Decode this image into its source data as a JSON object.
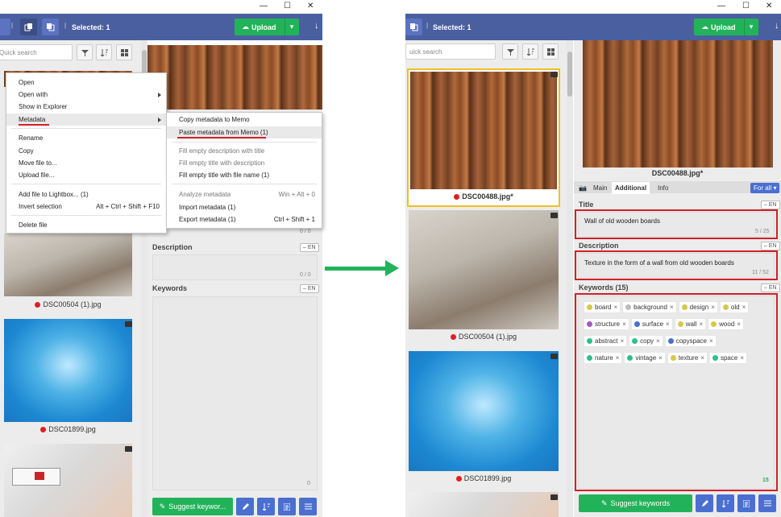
{
  "left": {
    "selected_label": "Selected: 1",
    "upload_label": "Upload",
    "search_placeholder": "Quick search",
    "thumbs": [
      {
        "caption": "DSC00504 (1).jpg"
      },
      {
        "caption": "DSC01899.jpg"
      }
    ],
    "context_menu": {
      "items": [
        "Open",
        "Open with",
        "Show in Explorer",
        "Metadata",
        "Rename",
        "Copy",
        "Move file to...",
        "Upload file...",
        "Add file to Lightbox... (1)",
        "Invert selection",
        "Delete file"
      ],
      "invert_shortcut": "Alt + Ctrl + Shift + F10"
    },
    "submenu": {
      "items": [
        "Copy metadata to Memo",
        "Paste metadata from Memo (1)",
        "Fill empty description with title",
        "Fill empty title with description",
        "Fill empty title with file name (1)",
        "Analyze metadata",
        "Import metadata (1)",
        "Export metadata (1)"
      ],
      "analyze_shortcut": "Win + Alt + 0",
      "export_shortcut": "Ctrl + Shift + 1"
    },
    "fields": {
      "title_counter": "0 / 0",
      "description_label": "Description",
      "description_counter": "0 / 0",
      "keywords_label": "Keywords",
      "keywords_counter": "0",
      "lang": "EN"
    },
    "suggest_label": "Suggest keywor..."
  },
  "right": {
    "selected_label": "Selected: 1",
    "upload_label": "Upload",
    "search_placeholder": "uick search",
    "thumbs": [
      {
        "caption": "DSC00488.jpg*"
      },
      {
        "caption": "DSC00504 (1).jpg"
      },
      {
        "caption": "DSC01899.jpg"
      }
    ],
    "preview_filename": "DSC00488.jpg*",
    "tabs": [
      "Main",
      "Additional",
      "Info"
    ],
    "for_all": "For all",
    "title_label": "Title",
    "title_value": "Wall of old wooden boards",
    "title_counter": "5 / 25",
    "description_label": "Description",
    "description_value": "Texture in the form of a wall from old wooden boards",
    "description_counter": "11 / 52",
    "keywords_label": "Keywords (15)",
    "keywords_counter": "15",
    "lang": "EN",
    "keywords": [
      {
        "text": "board",
        "color": "#d6c94a"
      },
      {
        "text": "background",
        "color": "#bbbbbb"
      },
      {
        "text": "design",
        "color": "#d6c94a"
      },
      {
        "text": "old",
        "color": "#d6c94a"
      },
      {
        "text": "structure",
        "color": "#a25ac8"
      },
      {
        "text": "surface",
        "color": "#4a6fd0"
      },
      {
        "text": "wall",
        "color": "#d6c94a"
      },
      {
        "text": "wood",
        "color": "#d6c94a"
      },
      {
        "text": "abstract",
        "color": "#2fbf8a"
      },
      {
        "text": "copy",
        "color": "#2fbf8a"
      },
      {
        "text": "copyspace",
        "color": "#4a6fd0"
      },
      {
        "text": "nature",
        "color": "#2fbf8a"
      },
      {
        "text": "vintage",
        "color": "#2fbf8a"
      },
      {
        "text": "texture",
        "color": "#d6c94a"
      },
      {
        "text": "space",
        "color": "#2fbf8a"
      }
    ],
    "suggest_label": "Suggest keywords"
  },
  "colors": {
    "header": "#4a5fa0",
    "accent_green": "#22b35a",
    "highlight_red": "#d0202a",
    "action_blue": "#4a6fd0"
  }
}
